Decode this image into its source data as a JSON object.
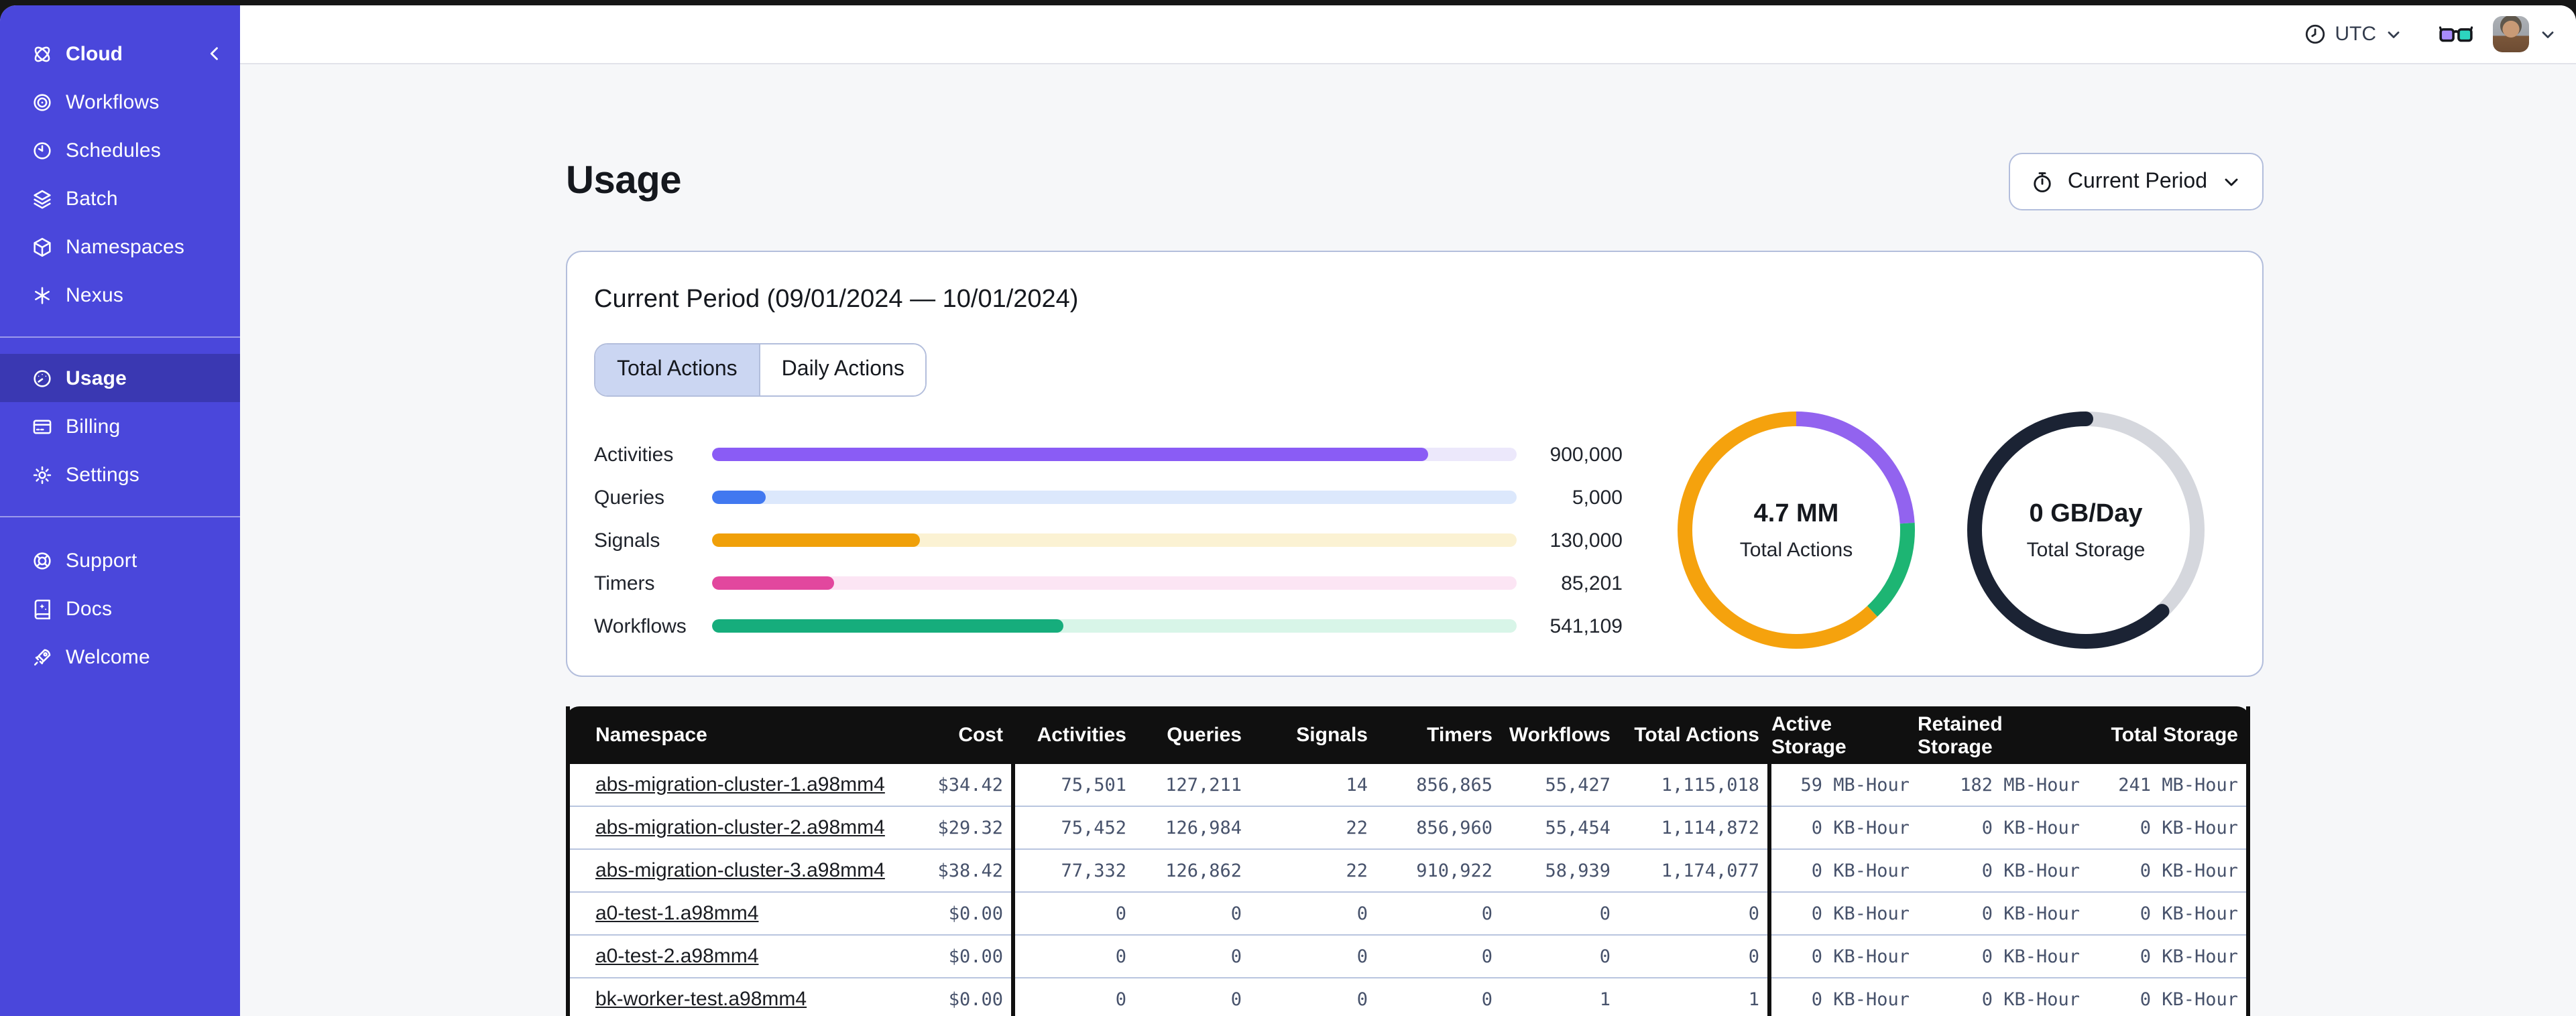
{
  "header": {
    "timezone": "UTC",
    "icons": {
      "clock": "clock-icon",
      "glasses": "glasses-icon",
      "avatar": "user-avatar",
      "caret": "chevron-down-icon"
    }
  },
  "sidebar": {
    "logo_label": "Cloud",
    "groups": [
      {
        "items": [
          {
            "label": "Workflows",
            "icon": "workflows-icon"
          },
          {
            "label": "Schedules",
            "icon": "schedules-icon"
          },
          {
            "label": "Batch",
            "icon": "batch-icon"
          },
          {
            "label": "Namespaces",
            "icon": "namespaces-icon"
          },
          {
            "label": "Nexus",
            "icon": "nexus-icon"
          }
        ]
      },
      {
        "items": [
          {
            "label": "Usage",
            "icon": "usage-icon",
            "selected": true
          },
          {
            "label": "Billing",
            "icon": "billing-icon"
          },
          {
            "label": "Settings",
            "icon": "settings-icon"
          }
        ]
      },
      {
        "items": [
          {
            "label": "Support",
            "icon": "support-icon"
          },
          {
            "label": "Docs",
            "icon": "docs-icon"
          },
          {
            "label": "Welcome",
            "icon": "welcome-icon"
          }
        ]
      }
    ]
  },
  "page": {
    "title": "Usage",
    "period_button_label": "Current Period"
  },
  "card": {
    "heading": "Current Period (09/01/2024 — 10/01/2024)",
    "tabs": [
      {
        "label": "Total Actions",
        "selected": true
      },
      {
        "label": "Daily Actions",
        "selected": false
      }
    ]
  },
  "chart_data": [
    {
      "type": "bar",
      "title": "Usage by action type (current period)",
      "categories": [
        "Activities",
        "Queries",
        "Signals",
        "Timers",
        "Workflows"
      ],
      "values": [
        900000,
        5000,
        130000,
        85201,
        541109
      ],
      "display_values": [
        "900,000",
        "5,000",
        "130,000",
        "85,201",
        "541,109"
      ],
      "fill_percents": [
        89,
        6.7,
        25.8,
        15.2,
        43.7
      ],
      "bar_colors": [
        "#8A5CF5",
        "#4178F0",
        "#F0A009",
        "#E2479E",
        "#16AD7C"
      ],
      "track_colors": [
        "#ECE8FB",
        "#DCE8FC",
        "#FBF2D3",
        "#FCE5F4",
        "#D8F5E8"
      ],
      "xlabel": "",
      "ylabel": "",
      "legend": false,
      "grid": false
    },
    {
      "type": "pie",
      "subtype": "donut",
      "center_value": "4.7 MM",
      "center_label": "Total Actions",
      "segments": [
        {
          "name": "purple",
          "color": "#9263EF",
          "pct": 24,
          "cap": "butt"
        },
        {
          "name": "green",
          "color": "#1DB573",
          "pct": 14,
          "cap": "butt"
        },
        {
          "name": "orange",
          "color": "#F5A20D",
          "pct": 62,
          "cap": "butt"
        }
      ]
    },
    {
      "type": "pie",
      "subtype": "donut",
      "center_value": "0 GB/Day",
      "center_label": "Total Storage",
      "segments": [
        {
          "name": "gray",
          "color": "#D5D7DD",
          "pct": 38,
          "cap": "butt"
        },
        {
          "name": "dark",
          "color": "#1B2334",
          "pct": 62,
          "cap": "round"
        }
      ]
    }
  ],
  "table": {
    "columns": [
      {
        "id": "namespace",
        "label": "Namespace",
        "align": "left"
      },
      {
        "id": "cost",
        "label": "Cost",
        "align": "right"
      },
      {
        "id": "activities",
        "label": "Activities",
        "align": "right"
      },
      {
        "id": "queries",
        "label": "Queries",
        "align": "right"
      },
      {
        "id": "signals",
        "label": "Signals",
        "align": "right"
      },
      {
        "id": "timers",
        "label": "Timers",
        "align": "right"
      },
      {
        "id": "workflows",
        "label": "Workflows",
        "align": "right"
      },
      {
        "id": "total_actions",
        "label": "Total Actions",
        "align": "right"
      },
      {
        "id": "active_storage",
        "label": "Active Storage",
        "align": "right"
      },
      {
        "id": "retained_storage",
        "label": "Retained Storage",
        "align": "right"
      },
      {
        "id": "total_storage",
        "label": "Total Storage",
        "align": "right"
      }
    ],
    "rows": [
      [
        "abs-migration-cluster-1.a98mm4",
        "$34.42",
        "75,501",
        "127,211",
        "14",
        "856,865",
        "55,427",
        "1,115,018",
        "59 MB-Hour",
        "182 MB-Hour",
        "241 MB-Hour"
      ],
      [
        "abs-migration-cluster-2.a98mm4",
        "$29.32",
        "75,452",
        "126,984",
        "22",
        "856,960",
        "55,454",
        "1,114,872",
        "0 KB-Hour",
        "0 KB-Hour",
        "0 KB-Hour"
      ],
      [
        "abs-migration-cluster-3.a98mm4",
        "$38.42",
        "77,332",
        "126,862",
        "22",
        "910,922",
        "58,939",
        "1,174,077",
        "0 KB-Hour",
        "0 KB-Hour",
        "0 KB-Hour"
      ],
      [
        "a0-test-1.a98mm4",
        "$0.00",
        "0",
        "0",
        "0",
        "0",
        "0",
        "0",
        "0 KB-Hour",
        "0 KB-Hour",
        "0 KB-Hour"
      ],
      [
        "a0-test-2.a98mm4",
        "$0.00",
        "0",
        "0",
        "0",
        "0",
        "0",
        "0",
        "0 KB-Hour",
        "0 KB-Hour",
        "0 KB-Hour"
      ],
      [
        "bk-worker-test.a98mm4",
        "$0.00",
        "0",
        "0",
        "0",
        "0",
        "1",
        "1",
        "0 KB-Hour",
        "0 KB-Hour",
        "0 KB-Hour"
      ]
    ]
  },
  "colors": {
    "sidebar_bg": "#4A47DB",
    "sidebar_selected_bg": "#3A38B2",
    "table_header_bg": "#101010",
    "card_border": "#B3BEDC",
    "row_divider": "#B9C5DF",
    "content_bg": "#F6F7F9"
  }
}
